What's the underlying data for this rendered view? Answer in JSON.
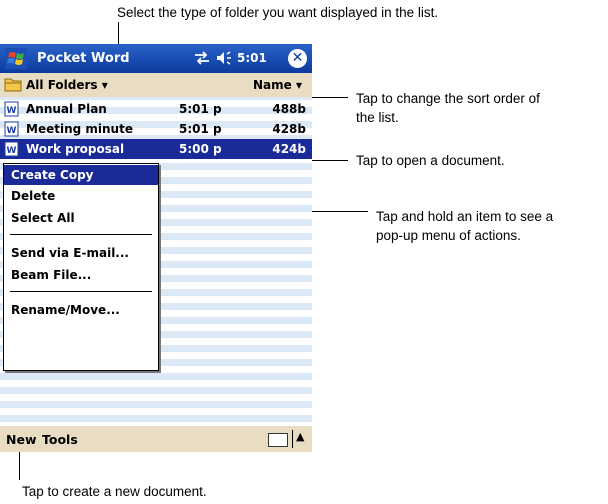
{
  "callouts": {
    "top": "Select the type of folder you want displayed in the list.",
    "sort_line1": "Tap to change the sort order of",
    "sort_line2": "the list.",
    "open": "Tap to open a document.",
    "hold_line1": "Tap and hold an item to see a",
    "hold_line2": "pop-up menu of actions.",
    "bottom": "Tap to create a new document."
  },
  "titlebar": {
    "title": "Pocket Word",
    "time": "5:01",
    "close_glyph": "✕",
    "close_icon": "close-icon"
  },
  "folderbar": {
    "folder_label": "All Folders",
    "folder_arrow": "▾",
    "sort_label": "Name",
    "sort_arrow": "▾"
  },
  "files": [
    {
      "name": "Annual  Plan",
      "time": "5:01 p",
      "size": "488b",
      "selected": false
    },
    {
      "name": "Meeting minute",
      "time": "5:01 p",
      "size": "428b",
      "selected": false
    },
    {
      "name": "Work proposal",
      "time": "5:00 p",
      "size": "424b",
      "selected": true
    }
  ],
  "menu": {
    "items": [
      "Create Copy",
      "Delete",
      "Select All",
      "Send via E-mail...",
      "Beam File...",
      "Rename/Move..."
    ],
    "highlighted_index": 0
  },
  "commandbar": {
    "new_label": "New",
    "tools_label": "Tools",
    "up_glyph": "▲"
  },
  "colors": {
    "titlebar": "#0b3a9e",
    "selection": "#1a2a99",
    "bars": "#e8ddc3",
    "stripe": "#dbe8f5"
  }
}
